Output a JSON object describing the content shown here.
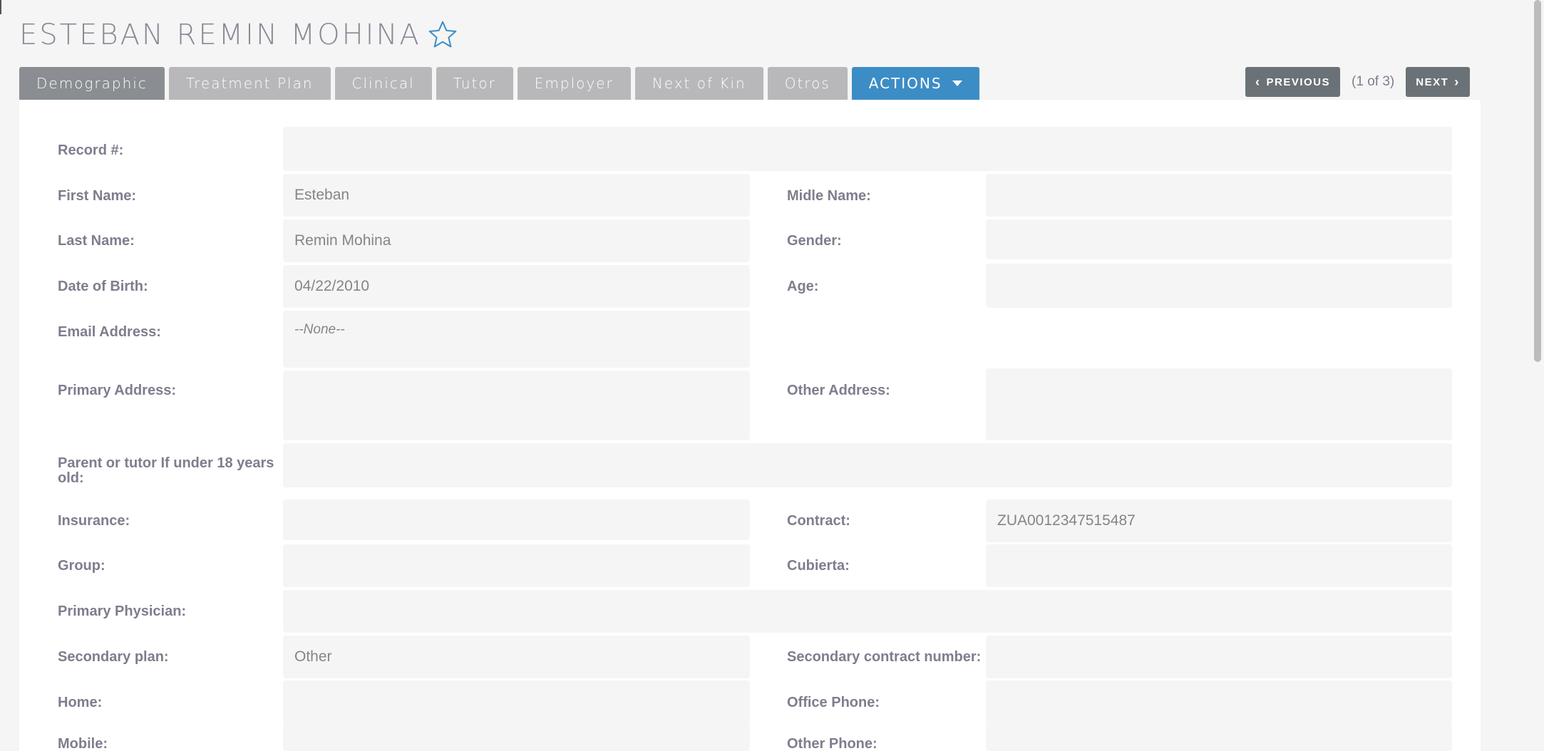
{
  "record": {
    "title": "ESTEBAN REMIN MOHINA",
    "favorite_icon": "star-outline-icon",
    "accent_color": "#3c8dc5"
  },
  "tabs": [
    {
      "label": "Demographic",
      "active": true
    },
    {
      "label": "Treatment Plan"
    },
    {
      "label": "Clinical"
    },
    {
      "label": "Tutor"
    },
    {
      "label": "Employer"
    },
    {
      "label": "Next of Kin"
    },
    {
      "label": "Otros"
    },
    {
      "label": "ACTIONS",
      "icon": "caret-down-icon"
    }
  ],
  "pager": {
    "previous": "PREVIOUS",
    "count": "(1 of 3)",
    "next": "NEXT",
    "previous_icon": "chevron-left-icon",
    "next_icon": "chevron-right-icon"
  },
  "form": {
    "record_no": {
      "label": "Record #:",
      "value": ""
    },
    "first_name": {
      "label": "First Name:",
      "value": "Esteban"
    },
    "middle_name": {
      "label": "Midle Name:",
      "value": ""
    },
    "last_name": {
      "label": "Last Name:",
      "value": "Remin Mohina"
    },
    "gender": {
      "label": "Gender:",
      "value": ""
    },
    "dob": {
      "label": "Date of Birth:",
      "value": "04/22/2010"
    },
    "age": {
      "label": "Age:",
      "value": ""
    },
    "email": {
      "label": "Email Address:",
      "value": "--None--"
    },
    "primary_address": {
      "label": "Primary Address:",
      "value": ""
    },
    "other_address": {
      "label": "Other Address:",
      "value": ""
    },
    "parent_tutor": {
      "label": "Parent or tutor If under 18 years old:",
      "value": ""
    },
    "insurance": {
      "label": "Insurance:",
      "value": ""
    },
    "contract": {
      "label": "Contract:",
      "value": "ZUA0012347515487"
    },
    "group": {
      "label": "Group:",
      "value": ""
    },
    "cubierta": {
      "label": "Cubierta:",
      "value": ""
    },
    "primary_physician": {
      "label": "Primary Physician:",
      "value": ""
    },
    "secondary_plan": {
      "label": "Secondary plan:",
      "value": "Other"
    },
    "secondary_contract": {
      "label": "Secondary contract number:",
      "value": ""
    },
    "home": {
      "label": "Home:",
      "value": ""
    },
    "office_phone": {
      "label": "Office Phone:",
      "value": ""
    },
    "mobile": {
      "label": "Mobile:",
      "value": ""
    },
    "other_phone": {
      "label": "Other Phone:",
      "value": ""
    }
  }
}
